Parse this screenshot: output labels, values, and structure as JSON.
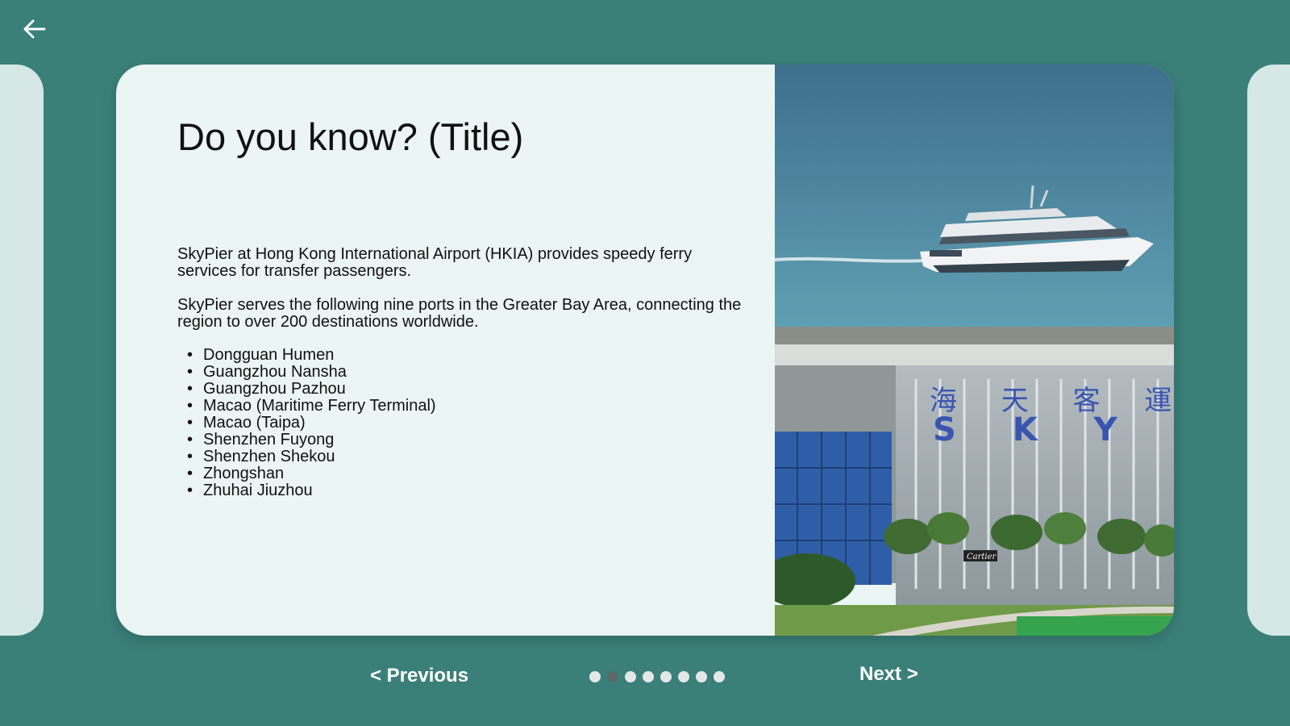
{
  "slide": {
    "title": "Do you know? (Title)",
    "paragraphs": [
      "SkyPier at Hong Kong International Airport (HKIA) provides speedy ferry services for transfer passengers.",
      "SkyPier serves the following nine ports in the Greater Bay Area, connecting the region to over 200 destinations worldwide."
    ],
    "ports": [
      "Dongguan Humen",
      "Guangzhou Nansha",
      "Guangzhou Pazhou",
      "Macao (Maritime Ferry Terminal)",
      "Macao (Taipa)",
      "Shenzhen Fuyong",
      "Shenzhen Shekou",
      "Zhongshan",
      "Zhuhai Jiuzhou"
    ],
    "image": {
      "sign_chinese": "海 天 客 運",
      "sign_latin": "S K Y P",
      "shop_sign": "Cartier"
    }
  },
  "nav": {
    "back_icon": "arrow-left-icon",
    "previous_label": "< Previous",
    "next_label": "Next >",
    "page_count": 8,
    "active_page": 2
  },
  "colors": {
    "background": "#3a8079",
    "card": "#ebf5f3",
    "side_card": "#d5e8e6",
    "dot": "#e3e8e7",
    "dot_active": "#5a6a68"
  }
}
